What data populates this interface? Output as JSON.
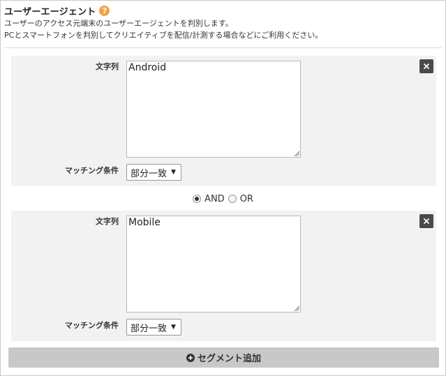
{
  "header": {
    "title": "ユーザーエージェント",
    "help_icon": "question-circle-icon",
    "help_glyph": "?",
    "description_line1": "ユーザーのアクセス元端末のユーザーエージェントを判別します。",
    "description_line2": "PCとスマートフォンを判別してクリエイティブを配信/計測する場合などにご利用ください。"
  },
  "segments": [
    {
      "string_label": "文字列",
      "string_value": "Android",
      "match_label": "マッチング条件",
      "match_selected": "部分一致",
      "close_icon": "close-icon"
    },
    {
      "string_label": "文字列",
      "string_value": "Mobile",
      "match_label": "マッチング条件",
      "match_selected": "部分一致",
      "close_icon": "close-icon"
    }
  ],
  "logic": {
    "options": [
      "AND",
      "OR"
    ],
    "selected": "AND"
  },
  "add_segment": {
    "label": "セグメント追加",
    "icon": "plus-circle-icon"
  },
  "colors": {
    "help_icon": "#f0a34a",
    "segment_bg": "#f2f2f2",
    "close_button": "#4a4a4a",
    "add_button": "#c8c8c8"
  }
}
